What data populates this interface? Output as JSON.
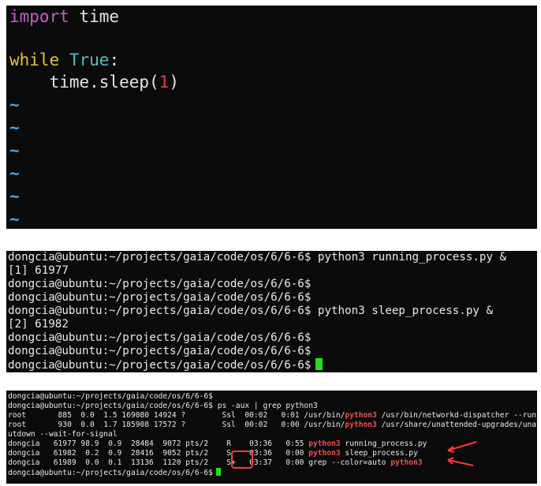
{
  "editor": {
    "line1": {
      "kw": "import",
      "rest": " time"
    },
    "line3": {
      "kw": "while",
      "sp": " ",
      "true": "True",
      "colon": ":"
    },
    "line4": {
      "indent": "    ",
      "call": "time.sleep(",
      "arg": "1",
      "close": ")"
    },
    "tilde": "~"
  },
  "term1": {
    "lines": [
      "dongcia@ubuntu:~/projects/gaia/code/os/6/6-6$ python3 running_process.py &",
      "[1] 61977",
      "dongcia@ubuntu:~/projects/gaia/code/os/6/6-6$",
      "dongcia@ubuntu:~/projects/gaia/code/os/6/6-6$",
      "dongcia@ubuntu:~/projects/gaia/code/os/6/6-6$ python3 sleep_process.py &",
      "[2] 61982",
      "dongcia@ubuntu:~/projects/gaia/code/os/6/6-6$",
      "dongcia@ubuntu:~/projects/gaia/code/os/6/6-6$",
      "dongcia@ubuntu:~/projects/gaia/code/os/6/6-6$"
    ]
  },
  "term2": {
    "l1": "dongcia@ubuntu:~/projects/gaia/code/os/6/6-6$",
    "l2": "dongcia@ubuntu:~/projects/gaia/code/os/6/6-6$ ps -aux | grep python3",
    "l3a": "root       885  0.0  1.5 169080 14924 ?        Ssl  00:02   0:01 /usr/bin/",
    "l3b": "python3",
    "l3c": " /usr/bin/networkd-dispatcher --run-s",
    "l4a": "root       930  0.0  1.7 185908 17572 ?        Ssl  00:02   0:00 /usr/bin/",
    "l4b": "python3",
    "l4c": " /usr/share/unattended-upgrades/unatten",
    "l5": "utdown --wait-for-signal",
    "l6a": "dongcia   61977 98.9  0.9  28484  9072 pts/2    R    03:36   0:55 ",
    "l6b": "python3",
    "l6c": " running_process.py",
    "l7a": "dongcia   61982  0.2  0.9  28416  9052 pts/2    S    03:36   0:00 ",
    "l7b": "python3",
    "l7c": " sleep_process.py",
    "l8a": "dongcia   61989  0.0  0.1  13136  1120 pts/2    S+   03:37   0:00 grep --color=auto ",
    "l8b": "python3",
    "l9": "dongcia@ubuntu:~/projects/gaia/code/os/6/6-6$"
  },
  "colors": {
    "terminal_bg": "#0b0b0b",
    "keyword_import": "#c95bd1",
    "keyword_while": "#e0c345",
    "keyword_true": "#4fc0c6",
    "number": "#d64545",
    "tilde": "#4aa3e8",
    "cursor": "#21e021",
    "grep_match": "#f05050",
    "annotation": "#ff3b2f"
  }
}
